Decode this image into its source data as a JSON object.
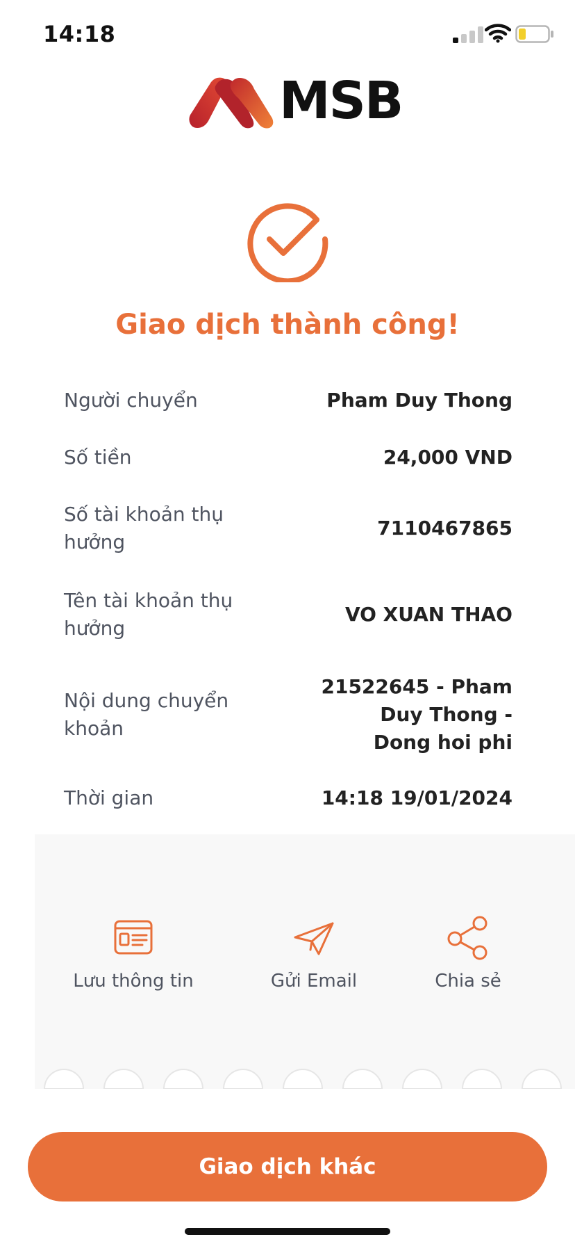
{
  "status_bar": {
    "time": "14:18"
  },
  "brand": {
    "name": "MSB"
  },
  "result": {
    "title": "Giao dịch thành công!"
  },
  "details": [
    {
      "label": "Người chuyển",
      "value": "Pham Duy Thong"
    },
    {
      "label": "Số tiền",
      "value": "24,000 VND"
    },
    {
      "label": "Số tài khoản thụ hưởng",
      "value": "7110467865"
    },
    {
      "label": "Tên tài khoản thụ hưởng",
      "value": "VO XUAN THAO"
    },
    {
      "label": "Nội dung chuyển khoản",
      "value": "21522645 - Pham Duy Thong - Dong hoi phi"
    },
    {
      "label": "Thời gian",
      "value": "14:18 19/01/2024"
    }
  ],
  "actions": [
    {
      "label": "Lưu thông tin",
      "icon": "receipt-card-icon"
    },
    {
      "label": "Gửi Email",
      "icon": "paper-plane-icon"
    },
    {
      "label": "Chia sẻ",
      "icon": "share-icon"
    }
  ],
  "primary_button": {
    "label": "Giao dịch khác"
  },
  "colors": {
    "accent": "#e8703a",
    "brand_red": "#c62a2e",
    "text_label": "#4f5460",
    "text_value": "#222222"
  }
}
